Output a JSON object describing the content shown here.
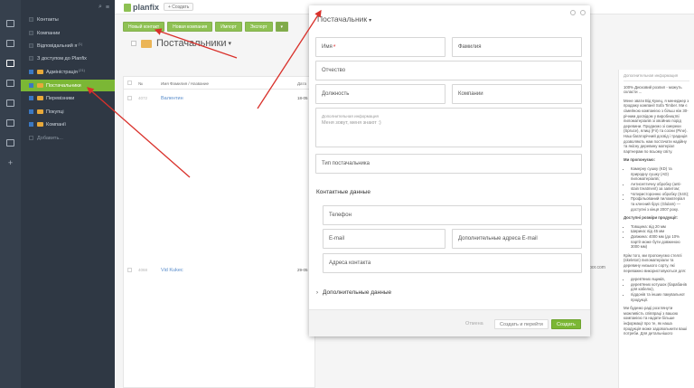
{
  "sidebar": {
    "items": [
      {
        "label": "Контакты",
        "count": ""
      },
      {
        "label": "Компании",
        "count": ""
      },
      {
        "label": "Відповідальний я",
        "count": "(1)"
      },
      {
        "label": "З доступом до Planfix",
        "count": ""
      },
      {
        "label": "Адміністрація",
        "count": "(21)"
      },
      {
        "label": "Постачальники",
        "count": ""
      },
      {
        "label": "Перевізники",
        "count": ""
      },
      {
        "label": "Покупці",
        "count": ""
      },
      {
        "label": "Компанії",
        "count": ""
      },
      {
        "label": "Добавить...",
        "count": ""
      }
    ]
  },
  "topbar": {
    "logo": "planfix",
    "create_label": "+ Создать"
  },
  "toolbar": {
    "new_contact": "Новый контакт",
    "new_company": "Новая компания",
    "import": "Импорт",
    "export": "Экспорт",
    "more": "▾"
  },
  "page": {
    "title": "Постачальники",
    "title_caret": "▾"
  },
  "table": {
    "headers": {
      "id": "№",
      "name": "Имя Фамилия / Название",
      "date": "Дата"
    },
    "rows": [
      {
        "id": "4072",
        "name": "Валентин",
        "date": "18-05"
      },
      {
        "id": "4068",
        "name": "Vid Kukec",
        "date": "29-05"
      }
    ]
  },
  "background_email": "ibor.com",
  "right_panel": {
    "header": "Дополнительная информация",
    "lines": [
      "100% Дисковий розпил - можуть скласти ...",
      "Мене звати Від Кукец, я менеджер з продажу компанії Sofa Timber. Ми є сімейною компанією з більш ніж 30-річним досвідом у виробництві пиломатеріалів зі хвойних порід деревини. Продаємо зі смереки (Spruce), ялиці (Fir) та сосни (Pine). Наш багаторічний досвід і традиція дозволяють нам постачати надійну та якісну деревину матеріал партнерам по всьому світу.",
      "Ми пропонуємо:",
      "Камерну сушку (KD) та природну сушку (AD) пиломатеріалів;",
      "Антисептичну обробку (anti-stain treatment) за запитом;",
      "Чотиристоронню обробку (S4S);",
      "Профільований пиломатеріал та клеєний брус (Glulam) — доступні з кінця 2007 року.",
      "Доступні розміри продукції:",
      "Товщина: від 20 мм",
      "Ширина: від 45 мм",
      "Довжина: 4000 мм (до 10% партії може бути довжиною 3000 мм)",
      "Крім того, ми пропонуємо стеллі (skeleton) пиломатеріали та деревину низького сорту, які переважно використовуються для:",
      "дерев'яних ящиків,",
      "дерев'яних котушок (барабанів для кабелю),",
      "піддонів та інших пакувальної продукції.",
      "Ми будемо раді розглянути можливість співпраці з вашою компанією та надати більше інформації про те, як наша продукція може задовольнити ваші потреби. Для детальнішого"
    ]
  },
  "modal": {
    "title": "Постачальник",
    "title_caret": "▾",
    "fields": {
      "first_name": "Имя",
      "required_mark": "*",
      "last_name": "Фамилия",
      "patronymic": "Отчество",
      "position": "Должность",
      "companies": "Компании",
      "additional_info_label": "Дополнительная информация",
      "additional_info_placeholder": "Меня зовут, меня знают :)",
      "supplier_type": "Тип постачальника",
      "phone": "Телефон",
      "email": "E-mail",
      "extra_email": "Дополнительные адреса E-mail",
      "contact_address": "Адреса контакта"
    },
    "section_contacts": "Контактные данные",
    "more_data": "Дополнительные данные",
    "buttons": {
      "cancel": "Отмена",
      "create_and_continue": "Создать и перейти",
      "create": "Создать"
    }
  },
  "colors": {
    "accent": "#7bb735",
    "annotation": "#d9312b",
    "sidebar": "#2f3844"
  }
}
